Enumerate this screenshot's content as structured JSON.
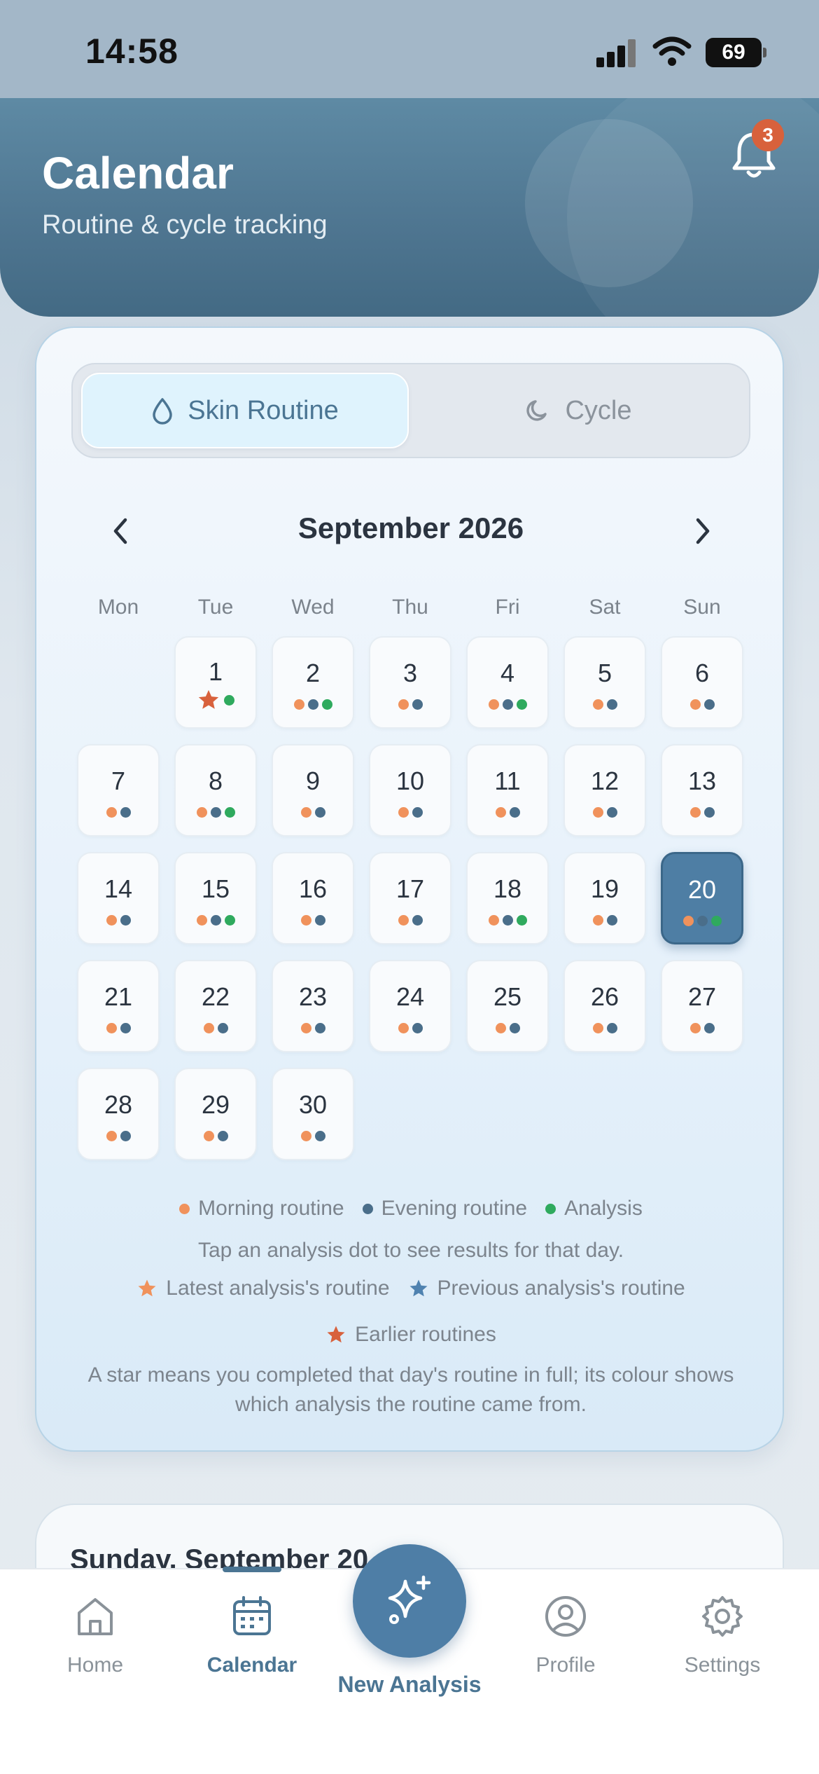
{
  "status_bar": {
    "time": "14:58",
    "battery": "69"
  },
  "header": {
    "title": "Calendar",
    "subtitle": "Routine & cycle tracking",
    "notification_count": "3"
  },
  "segments": {
    "skin_label": "Skin Routine",
    "cycle_label": "Cycle",
    "selected": "Skin Routine"
  },
  "calendar": {
    "month_title": "September 2026",
    "weekdays": [
      "Mon",
      "Tue",
      "Wed",
      "Thu",
      "Fri",
      "Sat",
      "Sun"
    ],
    "selected_day": "20",
    "days": [
      {
        "n": "1",
        "marks": [
          "star",
          "a"
        ]
      },
      {
        "n": "2",
        "marks": [
          "m",
          "e",
          "a"
        ]
      },
      {
        "n": "3",
        "marks": [
          "m",
          "e"
        ]
      },
      {
        "n": "4",
        "marks": [
          "m",
          "e",
          "a"
        ]
      },
      {
        "n": "5",
        "marks": [
          "m",
          "e"
        ]
      },
      {
        "n": "6",
        "marks": [
          "m",
          "e"
        ]
      },
      {
        "n": "7",
        "marks": [
          "m",
          "e"
        ]
      },
      {
        "n": "8",
        "marks": [
          "m",
          "e",
          "a"
        ]
      },
      {
        "n": "9",
        "marks": [
          "m",
          "e"
        ]
      },
      {
        "n": "10",
        "marks": [
          "m",
          "e"
        ]
      },
      {
        "n": "11",
        "marks": [
          "m",
          "e"
        ]
      },
      {
        "n": "12",
        "marks": [
          "m",
          "e"
        ]
      },
      {
        "n": "13",
        "marks": [
          "m",
          "e"
        ]
      },
      {
        "n": "14",
        "marks": [
          "m",
          "e"
        ]
      },
      {
        "n": "15",
        "marks": [
          "m",
          "e",
          "a"
        ]
      },
      {
        "n": "16",
        "marks": [
          "m",
          "e"
        ]
      },
      {
        "n": "17",
        "marks": [
          "m",
          "e"
        ]
      },
      {
        "n": "18",
        "marks": [
          "m",
          "e",
          "a"
        ]
      },
      {
        "n": "19",
        "marks": [
          "m",
          "e"
        ]
      },
      {
        "n": "20",
        "marks": [
          "m",
          "e",
          "a"
        ]
      },
      {
        "n": "21",
        "marks": [
          "m",
          "e"
        ]
      },
      {
        "n": "22",
        "marks": [
          "m",
          "e"
        ]
      },
      {
        "n": "23",
        "marks": [
          "m",
          "e"
        ]
      },
      {
        "n": "24",
        "marks": [
          "m",
          "e"
        ]
      },
      {
        "n": "25",
        "marks": [
          "m",
          "e"
        ]
      },
      {
        "n": "26",
        "marks": [
          "m",
          "e"
        ]
      },
      {
        "n": "27",
        "marks": [
          "m",
          "e"
        ]
      },
      {
        "n": "28",
        "marks": [
          "m",
          "e"
        ]
      },
      {
        "n": "29",
        "marks": [
          "m",
          "e"
        ]
      },
      {
        "n": "30",
        "marks": [
          "m",
          "e"
        ]
      }
    ]
  },
  "legend": {
    "morning": "Morning routine",
    "evening": "Evening routine",
    "analysis": "Analysis",
    "tap_hint": "Tap an analysis dot to see results for that day.",
    "latest": "Latest analysis's routine",
    "previous": "Previous analysis's routine",
    "earlier": "Earlier routines",
    "star_explain": "A star means you completed that day's routine in full; its colour shows which analysis the routine came from."
  },
  "detail": {
    "title": "Sunday, September 20"
  },
  "tabbar": {
    "home": "Home",
    "calendar": "Calendar",
    "new_analysis": "New Analysis",
    "profile": "Profile",
    "settings": "Settings",
    "active": "Calendar"
  },
  "colors": {
    "accent": "#4b7593",
    "morning_dot": "#f0925c",
    "evening_dot": "#4a6e8a",
    "analysis_dot": "#2faa5e",
    "latest_star": "#f0925c",
    "previous_star": "#4f82b0",
    "earlier_star": "#d8613c",
    "badge": "#d8613c"
  }
}
